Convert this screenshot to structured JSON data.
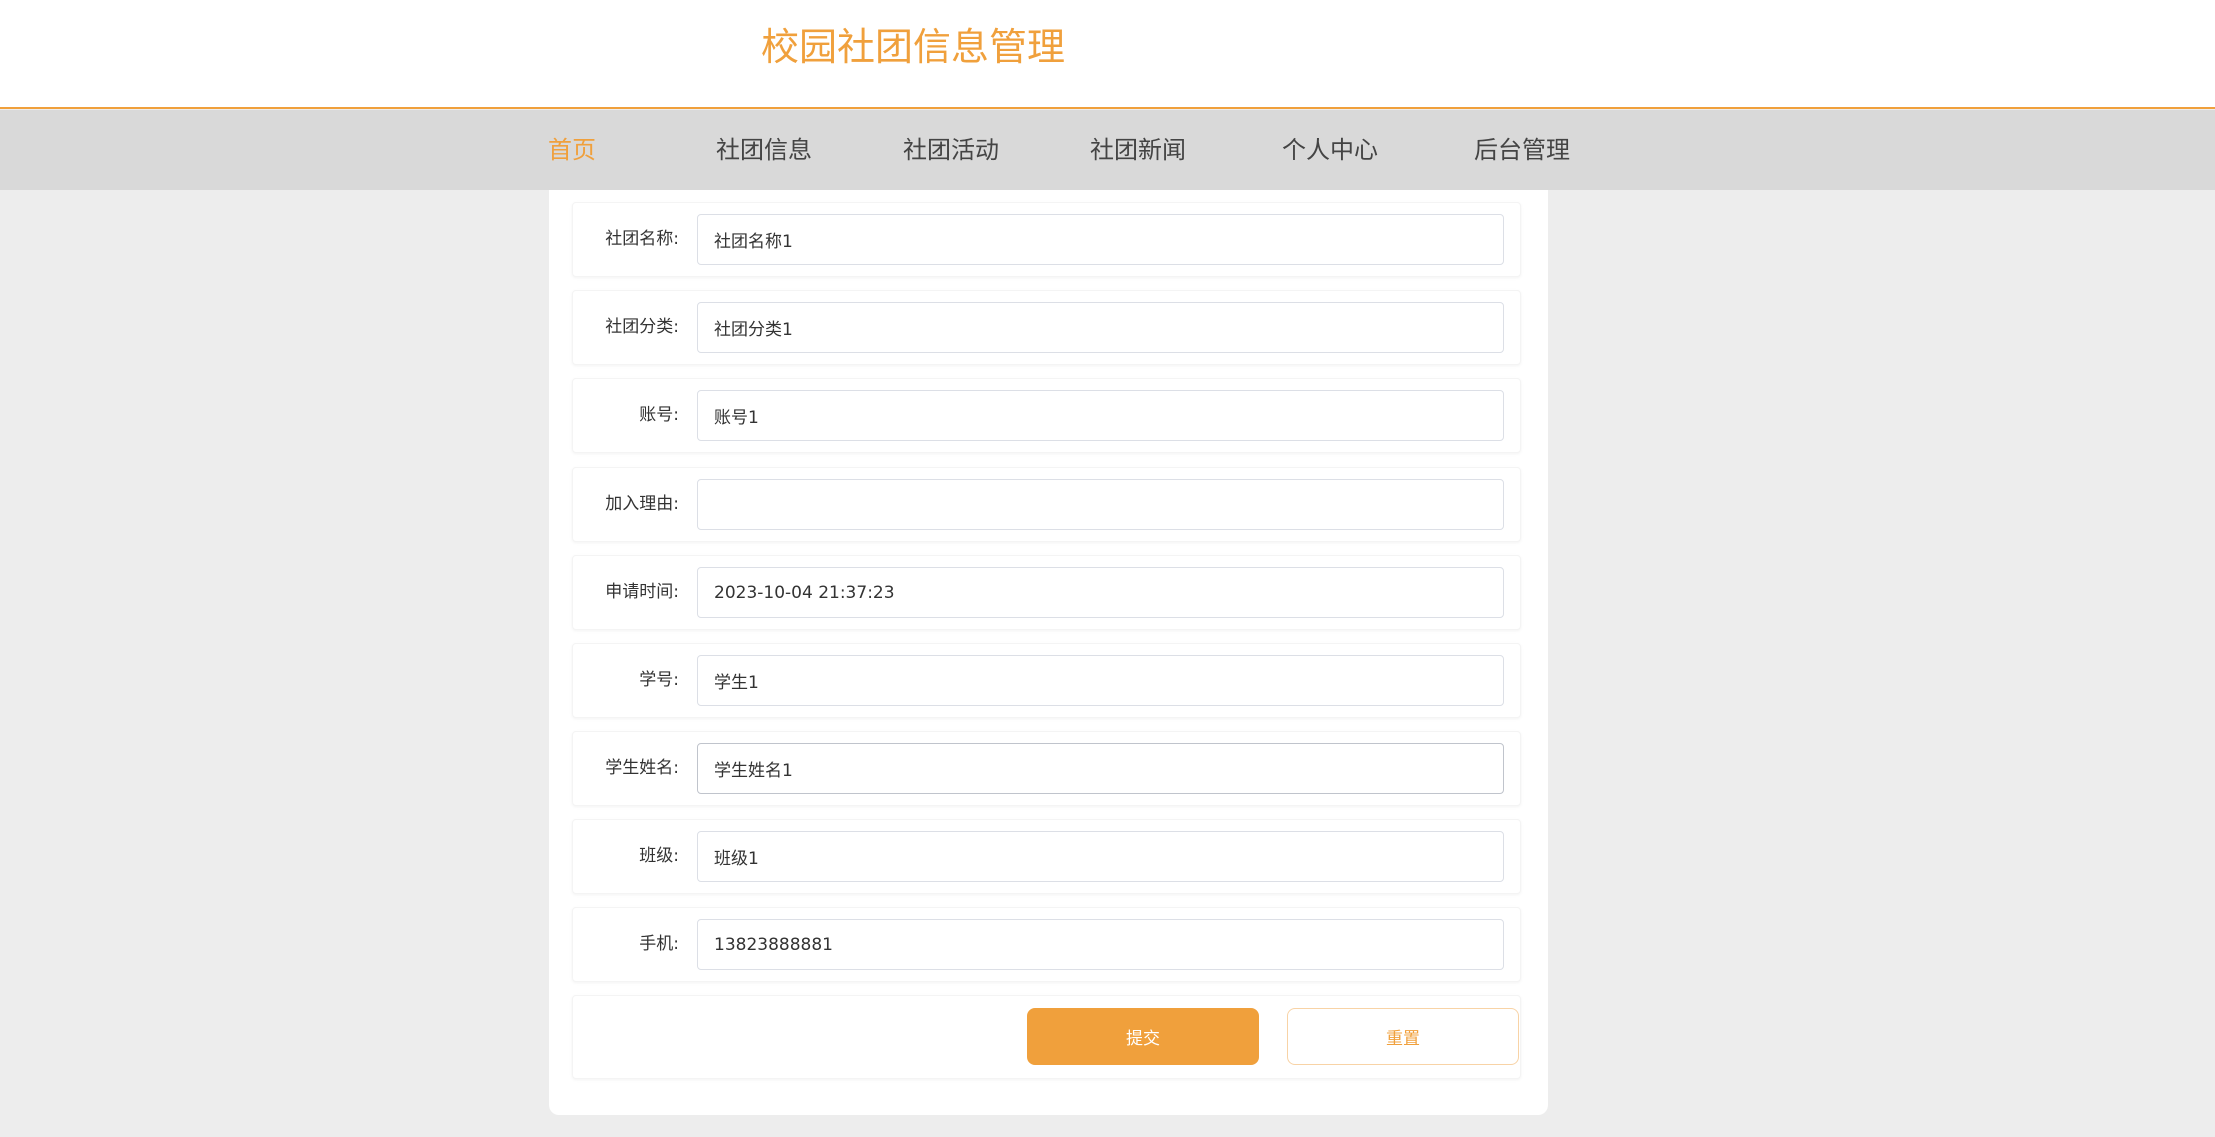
{
  "header": {
    "title": "校园社团信息管理"
  },
  "nav": {
    "items": [
      {
        "label": "首页",
        "active": true
      },
      {
        "label": "社团信息",
        "active": false
      },
      {
        "label": "社团活动",
        "active": false
      },
      {
        "label": "社团新闻",
        "active": false
      },
      {
        "label": "个人中心",
        "active": false
      },
      {
        "label": "后台管理",
        "active": false
      }
    ]
  },
  "form": {
    "fields": [
      {
        "label": "社团名称:",
        "value": "社团名称1"
      },
      {
        "label": "社团分类:",
        "value": "社团分类1"
      },
      {
        "label": "账号:",
        "value": "账号1"
      },
      {
        "label": "加入理由:",
        "value": ""
      },
      {
        "label": "申请时间:",
        "value": "2023-10-04 21:37:23"
      },
      {
        "label": "学号:",
        "value": "学生1"
      },
      {
        "label": "学生姓名:",
        "value": "学生姓名1"
      },
      {
        "label": "班级:",
        "value": "班级1"
      },
      {
        "label": "手机:",
        "value": "13823888881"
      }
    ],
    "submit_label": "提交",
    "reset_label": "重置"
  },
  "colors": {
    "accent": "#f0a03c",
    "nav_background": "#d9d9d9",
    "page_background": "#ededed"
  }
}
